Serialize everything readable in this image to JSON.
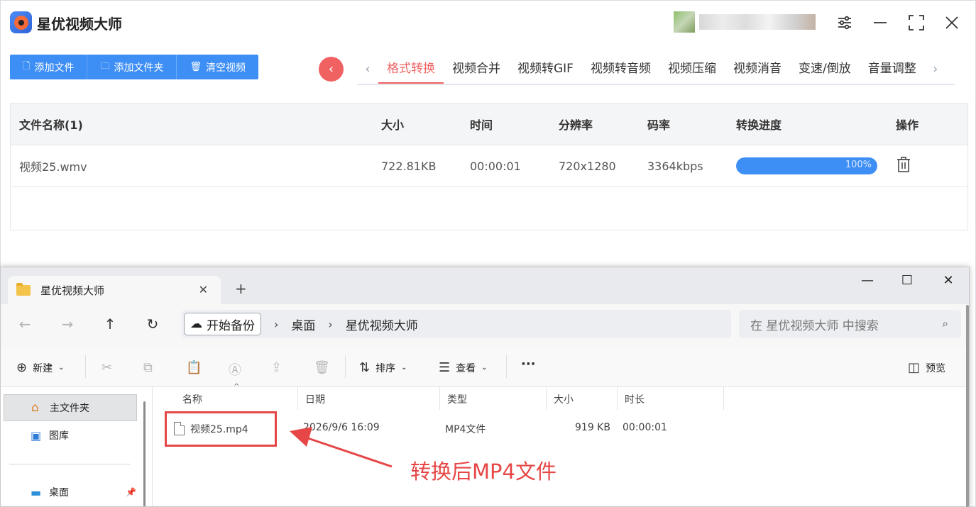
{
  "app": {
    "title": "星优视频大师",
    "buttons": {
      "add_file": "添加文件",
      "add_folder": "添加文件夹",
      "clear": "清空视频"
    },
    "tabs": [
      "格式转换",
      "视频合并",
      "视频转GIF",
      "视频转音频",
      "视频压缩",
      "视频消音",
      "变速/倒放",
      "音量调整"
    ],
    "active_tab": "格式转换",
    "table": {
      "headers": {
        "name": "文件名称(1)",
        "size": "大小",
        "time": "时间",
        "resolution": "分辨率",
        "bitrate": "码率",
        "progress": "转换进度",
        "action": "操作"
      },
      "rows": [
        {
          "name": "视频25.wmv",
          "size": "722.81KB",
          "time": "00:00:01",
          "resolution": "720x1280",
          "bitrate": "3364kbps",
          "progress_label": "100%",
          "progress": 1.0
        }
      ]
    },
    "colors": {
      "accent": "#3d8ef5",
      "active_tab": "#f06262"
    }
  },
  "explorer": {
    "tab_title": "星优视频大师",
    "breadcrumb": {
      "root": "开始备份",
      "items": [
        "桌面",
        "星优视频大师"
      ]
    },
    "search_placeholder": "在 星优视频大师 中搜索",
    "toolbar": {
      "new": "新建",
      "sort": "排序",
      "view": "查看",
      "more": "···",
      "preview": "预览"
    },
    "sidebar": {
      "home": "主文件夹",
      "gallery": "图库",
      "desktop": "桌面"
    },
    "columns": {
      "name": "名称",
      "date": "日期",
      "type": "类型",
      "size": "大小",
      "duration": "时长"
    },
    "files": [
      {
        "name": "视频25.mp4",
        "date": "2026/9/6 16:09",
        "type": "MP4文件",
        "size": "919 KB",
        "duration": "00:00:01"
      }
    ]
  },
  "annotation": {
    "text": "转换后MP4文件",
    "color": "#e64646"
  }
}
